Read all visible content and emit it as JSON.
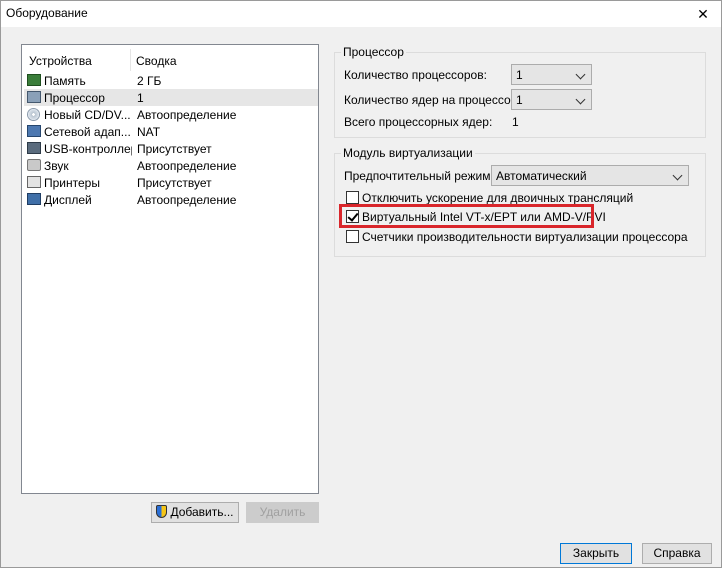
{
  "window": {
    "title": "Оборудование",
    "close_glyph": "✕"
  },
  "device_list": {
    "columns": [
      "Устройства",
      "Сводка"
    ],
    "rows": [
      {
        "icon": "memory-icon",
        "name": "Память",
        "summary": "2 ГБ"
      },
      {
        "icon": "processor-icon",
        "name": "Процессор",
        "summary": "1"
      },
      {
        "icon": "cd-dvd-icon",
        "name": "Новый CD/DV...",
        "summary": "Автоопределение"
      },
      {
        "icon": "network-adapter-icon",
        "name": "Сетевой адап...",
        "summary": "NAT"
      },
      {
        "icon": "usb-controller-icon",
        "name": "USB-контроллер",
        "summary": "Присутствует"
      },
      {
        "icon": "sound-icon",
        "name": "Звук",
        "summary": "Автоопределение"
      },
      {
        "icon": "printer-icon",
        "name": "Принтеры",
        "summary": "Присутствует"
      },
      {
        "icon": "display-icon",
        "name": "Дисплей",
        "summary": "Автоопределение"
      }
    ],
    "selected_index": 1
  },
  "buttons": {
    "add": "Добавить...",
    "remove": "Удалить",
    "close": "Закрыть",
    "help": "Справка"
  },
  "processor_group": {
    "legend": "Процессор",
    "num_processors_label": "Количество процессоров:",
    "num_processors_value": "1",
    "cores_label": "Количество ядер на процессор:",
    "cores_value": "1",
    "total_cores_label": "Всего процессорных ядер:",
    "total_cores_value": "1"
  },
  "virtualization_group": {
    "legend": "Модуль виртуализации",
    "mode_label": "Предпочтительный режим:",
    "mode_value": "Автоматический",
    "options": [
      {
        "label": "Отключить ускорение для двоичных трансляций",
        "checked": false
      },
      {
        "label": "Виртуальный Intel VT-x/EPT или AMD-V/RVI",
        "checked": true
      },
      {
        "label": "Счетчики производительности виртуализации процессора",
        "checked": false
      }
    ]
  },
  "colors": {
    "highlight": "#d9262b",
    "selection": "#e6e6e6",
    "focus": "#0078d7"
  }
}
